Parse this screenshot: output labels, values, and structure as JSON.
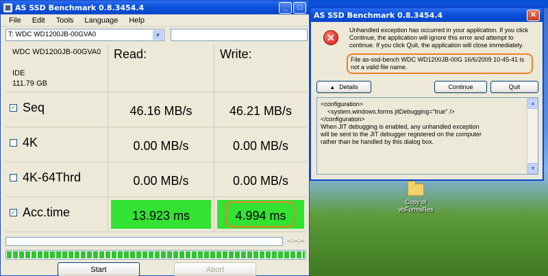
{
  "main_window": {
    "title": "AS SSD Benchmark 0.8.3454.4",
    "menu": [
      "File",
      "Edit",
      "Tools",
      "Language",
      "Help"
    ],
    "drive_select": "T: WDC WD1200JB-00GVA0",
    "drive_info": {
      "name": "WDC WD1200JB-00GVA0",
      "type": "IDE",
      "size": "111.79 GB"
    },
    "headers": {
      "read": "Read:",
      "write": "Write:"
    },
    "tests": [
      {
        "name": "Seq",
        "checked": true,
        "read": "46.16 MB/s",
        "write": "46.21 MB/s"
      },
      {
        "name": "4K",
        "checked": false,
        "read": "0.00 MB/s",
        "write": "0.00 MB/s"
      },
      {
        "name": "4K-64Thrd",
        "checked": false,
        "read": "0.00 MB/s",
        "write": "0.00 MB/s"
      },
      {
        "name": "Acc.time",
        "checked": true,
        "read": "13.923 ms",
        "write": "4.994 ms"
      }
    ],
    "elapsed": "--:--:--",
    "start_label": "Start",
    "abort_label": "Abort",
    "total_progress": 1.0,
    "accent_color": "#33e233"
  },
  "dialog": {
    "title": "AS SSD Benchmark 0.8.3454.4",
    "message": "Unhandled exception has occurred in your application. If you click Continue, the application will ignore this error and attempt to continue. If you click Quit, the application will close immediately.",
    "error_detail": "File as-ssd-bench WDC WD1200JB-00G 16/6/2009 10-45-41 is not a valid file name.",
    "details_label": "Details",
    "continue_label": "Continue",
    "quit_label": "Quit",
    "details_text": [
      "<configuration>",
      "    <system.windows.forms jitDebugging=\"true\" />",
      "</configuration>",
      "",
      "When JIT debugging is enabled, any unhandled exception",
      "will be sent to the JIT debugger registered on the computer",
      "rather than be handled by this dialog box."
    ]
  },
  "desktop": {
    "icon_label_1": "Copy of",
    "icon_label_2": "vbFormsRes"
  }
}
